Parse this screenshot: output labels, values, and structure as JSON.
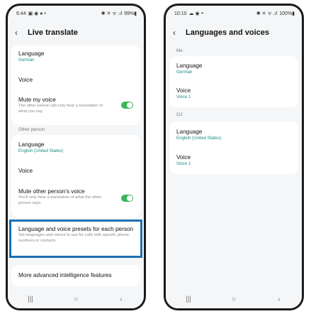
{
  "left": {
    "status": {
      "time": "6:44",
      "left_icons": "▣ ◉ ● •",
      "right_icons": "✱ ✕ ᯤ .ıl",
      "battery": "99%▮"
    },
    "title": "Live translate",
    "me": {
      "language_label": "Language",
      "language_value": "German",
      "voice_label": "Voice",
      "mute_label": "Mute my voice",
      "mute_desc": "The other person will only hear a translation of what you say."
    },
    "other_person_label": "Other person",
    "other": {
      "language_label": "Language",
      "language_value": "English (United States)",
      "voice_label": "Voice",
      "mute_label": "Mute other person's voice",
      "mute_desc": "You'll only hear a translation of what the other person says."
    },
    "presets": {
      "title": "Language and voice presets for each person",
      "desc": "Set languages and voices to use for calls with specific phone numbers or contacts."
    },
    "advanced": "More advanced intelligence features"
  },
  "right": {
    "status": {
      "time": "10:10",
      "left_icons": "☁ ◉ ◓",
      "right_icons": "✱ ✕ ᯤ .ıl",
      "battery": "100%▮"
    },
    "title": "Languages and voices",
    "section_me": "Me",
    "me": {
      "language_label": "Language",
      "language_value": "German",
      "voice_label": "Voice",
      "voice_value": "Voice 1"
    },
    "section_other": "OJ",
    "other": {
      "language_label": "Language",
      "language_value": "English (United States)",
      "voice_label": "Voice",
      "voice_value": "Voice 1"
    }
  },
  "nav": {
    "recents": "|||",
    "home": "○",
    "back": "‹"
  },
  "icons": {
    "back": "‹"
  },
  "colors": {
    "accent": "#1a8a86",
    "toggle": "#3bb55a",
    "highlight": "#1f6fb2"
  }
}
